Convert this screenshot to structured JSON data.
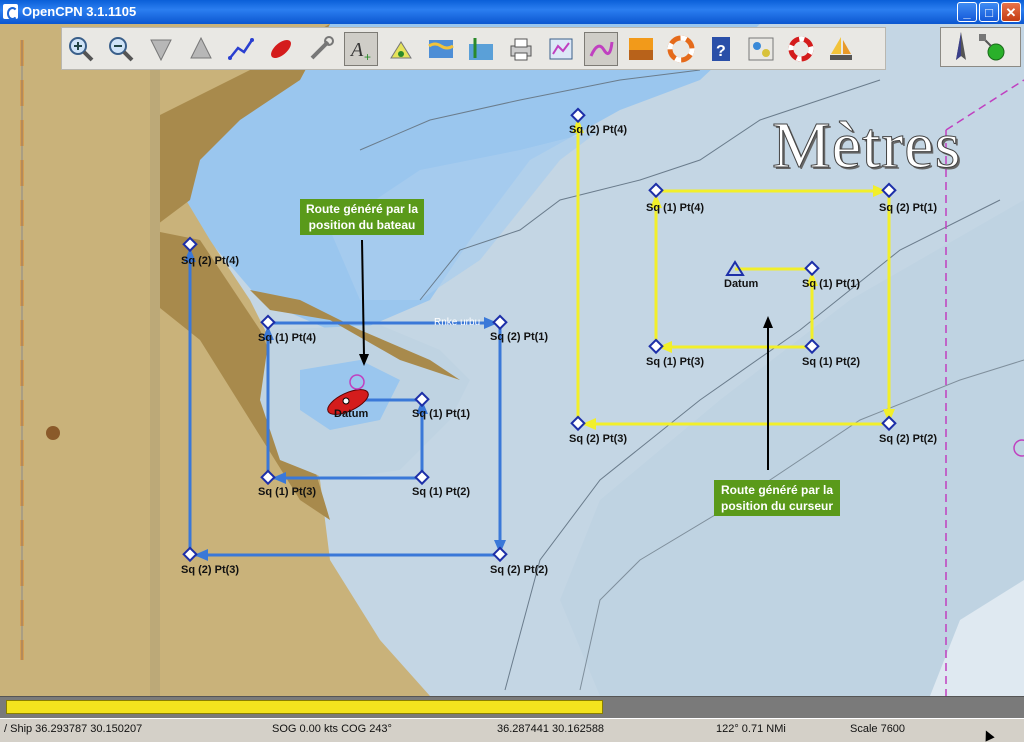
{
  "window": {
    "title": "OpenCPN 3.1.1105",
    "minimize": "_",
    "maximize": "□",
    "close": "✕"
  },
  "toolbar": {
    "buttons": [
      {
        "icon": "zoom-in-icon"
      },
      {
        "icon": "zoom-out-icon"
      },
      {
        "icon": "scale-down-icon"
      },
      {
        "icon": "scale-up-icon"
      },
      {
        "icon": "route-icon"
      },
      {
        "icon": "follow-ship-icon"
      },
      {
        "icon": "settings-icon"
      },
      {
        "icon": "text-icon"
      },
      {
        "icon": "current-icon"
      },
      {
        "icon": "tide-icon"
      },
      {
        "icon": "tide-level-icon"
      },
      {
        "icon": "print-icon"
      },
      {
        "icon": "route-manager-icon"
      },
      {
        "icon": "track-icon"
      },
      {
        "icon": "color-scheme-icon"
      },
      {
        "icon": "mob-icon"
      },
      {
        "icon": "help-icon"
      },
      {
        "icon": "plugin-icon"
      },
      {
        "icon": "lifebuoy-icon"
      },
      {
        "icon": "sailboat-icon"
      }
    ]
  },
  "overlay": {
    "units_label": "Mètres"
  },
  "annotations": {
    "boat_route": "Route généré par la position du bateau",
    "cursor_route": "Route généré par la position du curseur"
  },
  "map_labels": {
    "harbour_text": "Rnke urbu"
  },
  "waypoints": {
    "blue": {
      "s2p1": "Sq (2) Pt(1)",
      "s2p2": "Sq (2) Pt(2)",
      "s2p3": "Sq (2) Pt(3)",
      "s2p4": "Sq (2) Pt(4)",
      "s1p1": "Sq (1) Pt(1)",
      "s1p2": "Sq (1) Pt(2)",
      "s1p3": "Sq (1) Pt(3)",
      "s1p4": "Sq (1) Pt(4)",
      "datum": "Datum"
    },
    "yellow": {
      "s2p1": "Sq (2) Pt(1)",
      "s2p2": "Sq (2) Pt(2)",
      "s2p3": "Sq (2) Pt(3)",
      "s2p4": "Sq (2) Pt(4)",
      "s1p1": "Sq (1) Pt(1)",
      "s1p2": "Sq (1) Pt(2)",
      "s1p3": "Sq (1) Pt(3)",
      "s1p4": "Sq (1) Pt(4)",
      "datum": "Datum"
    }
  },
  "progress": {
    "fraction": 0.59
  },
  "status": {
    "ship": "/ Ship 36.293787   30.150207",
    "sog": "SOG 0.00 kts   COG 243°",
    "cursor": "36.287441   30.162588",
    "bearing": "122°   0.71 NMi",
    "scale": "Scale 7600"
  },
  "colors": {
    "blue_route": "#3a78d8",
    "yellow_route": "#f2ef2a",
    "land": "#c9b27a",
    "deep_water": "#c4d6e4",
    "shallow_water": "#9ac6ee"
  }
}
